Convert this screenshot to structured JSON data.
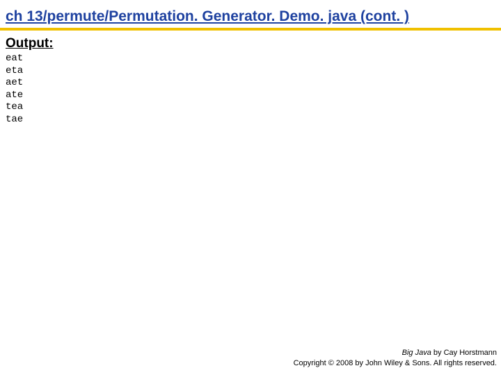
{
  "slide": {
    "title": "ch 13/permute/Permutation. Generator. Demo. java  (cont. )"
  },
  "section": {
    "output_label": "Output:"
  },
  "output": {
    "lines": [
      "eat",
      "eta",
      "aet",
      "ate",
      "tea",
      "tae"
    ]
  },
  "footer": {
    "book": "Big Java",
    "byline": " by Cay Horstmann",
    "copyright": "Copyright © 2008 by John Wiley & Sons. All rights reserved."
  }
}
